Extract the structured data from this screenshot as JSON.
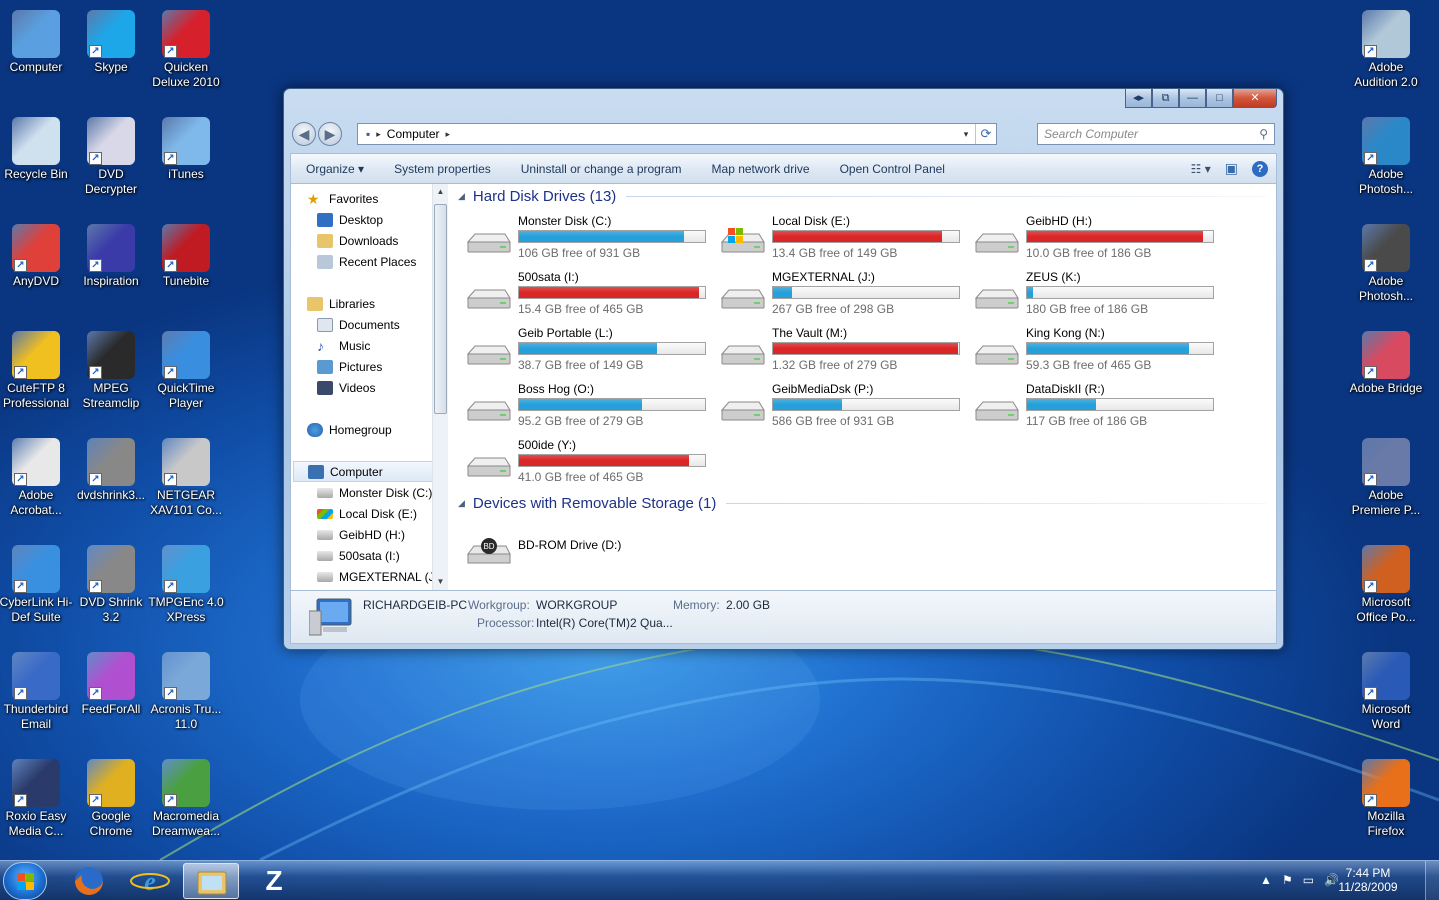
{
  "desktop": {
    "left_icons": [
      {
        "label": "Computer",
        "icon": "computer-icon",
        "color": "#5aa0e0"
      },
      {
        "label": "Skype",
        "icon": "skype-icon",
        "color": "#1ea7e8"
      },
      {
        "label": "Quicken Deluxe 2010",
        "icon": "quicken-icon",
        "color": "#d6202b"
      },
      {
        "label": "Recycle Bin",
        "icon": "recycle-bin-icon",
        "color": "#cfe0ef"
      },
      {
        "label": "DVD Decrypter",
        "icon": "dvd-decrypter-icon",
        "color": "#d8d8e8"
      },
      {
        "label": "iTunes",
        "icon": "itunes-icon",
        "color": "#7fb8ea"
      },
      {
        "label": "AnyDVD",
        "icon": "anydvd-icon",
        "color": "#e0403a"
      },
      {
        "label": "Inspiration",
        "icon": "inspiration-icon",
        "color": "#3a3aa8"
      },
      {
        "label": "Tunebite",
        "icon": "tunebite-icon",
        "color": "#c01a22"
      },
      {
        "label": "CuteFTP 8 Professional",
        "icon": "cuteftp-icon",
        "color": "#f0c020"
      },
      {
        "label": "MPEG Streamclip",
        "icon": "mpeg-streamclip-icon",
        "color": "#2a2a2a"
      },
      {
        "label": "QuickTime Player",
        "icon": "quicktime-icon",
        "color": "#3a8ee0"
      },
      {
        "label": "Adobe Acrobat...",
        "icon": "adobe-acrobat-icon",
        "color": "#e8e8e8"
      },
      {
        "label": "dvdshrink3...",
        "icon": "dvdshrink-icon",
        "color": "#888888"
      },
      {
        "label": "NETGEAR XAV101 Co...",
        "icon": "netgear-icon",
        "color": "#c8c8c8"
      },
      {
        "label": "CyberLink Hi-Def Suite",
        "icon": "cyberlink-icon",
        "color": "#3a90e0"
      },
      {
        "label": "DVD Shrink 3.2",
        "icon": "dvd-shrink-icon",
        "color": "#888888"
      },
      {
        "label": "TMPGEnc 4.0 XPress",
        "icon": "tmpgenc-icon",
        "color": "#3aa0e0"
      },
      {
        "label": "Thunderbird Email",
        "icon": "thunderbird-icon",
        "color": "#3a6ac8"
      },
      {
        "label": "FeedForAll",
        "icon": "feedforall-icon",
        "color": "#b050d0"
      },
      {
        "label": "Acronis Tru... 11.0",
        "icon": "acronis-icon",
        "color": "#7aa8d8"
      },
      {
        "label": "Roxio Easy Media C...",
        "icon": "roxio-icon",
        "color": "#2a3a6a"
      },
      {
        "label": "Google Chrome",
        "icon": "chrome-icon",
        "color": "#e0b020"
      },
      {
        "label": "Macromedia Dreamwea...",
        "icon": "dreamweaver-icon",
        "color": "#4aa040"
      }
    ],
    "right_icons": [
      {
        "label": "Adobe Audition 2.0",
        "icon": "adobe-audition-icon",
        "color": "#b0c8d8"
      },
      {
        "label": "Adobe Photosh...",
        "icon": "adobe-photoshop-icon",
        "color": "#2a88c8"
      },
      {
        "label": "Adobe Photosh...",
        "icon": "adobe-lightroom-icon",
        "color": "#4a4a4a"
      },
      {
        "label": "Adobe Bridge",
        "icon": "adobe-bridge-icon",
        "color": "#d84a60"
      },
      {
        "label": "Adobe Premiere P...",
        "icon": "adobe-premiere-icon",
        "color": "#6a7aa8"
      },
      {
        "label": "Microsoft Office Po...",
        "icon": "powerpoint-icon",
        "color": "#d06020"
      },
      {
        "label": "Microsoft Word",
        "icon": "word-icon",
        "color": "#2a5ab8"
      },
      {
        "label": "Mozilla Firefox",
        "icon": "firefox-icon",
        "color": "#e8701a"
      }
    ]
  },
  "window": {
    "caption_buttons": [
      "◂▸",
      "⧉",
      "—",
      "□",
      "✕"
    ],
    "address": {
      "root_glyph": "▪",
      "separator": "▸",
      "location": "Computer",
      "dropdown": "▾",
      "refresh": "⟳"
    },
    "search": {
      "placeholder": "Search Computer",
      "glyph": "⚲"
    },
    "toolbar": {
      "organize": "Organize ▾",
      "system_properties": "System properties",
      "uninstall": "Uninstall or change a program",
      "map_drive": "Map network drive",
      "control_panel": "Open Control Panel",
      "views_glyph": "☷ ▾",
      "preview_glyph": "▣",
      "help": "?"
    },
    "nav": {
      "favorites": "Favorites",
      "desktop": "Desktop",
      "downloads": "Downloads",
      "recent": "Recent Places",
      "libraries": "Libraries",
      "documents": "Documents",
      "music": "Music",
      "pictures": "Pictures",
      "videos": "Videos",
      "homegroup": "Homegroup",
      "computer": "Computer",
      "drives": [
        "Monster Disk (C:)",
        "Local Disk (E:)",
        "GeibHD (H:)",
        "500sata (I:)",
        "MGEXTERNAL (J:)"
      ]
    },
    "groups": {
      "hdd": "Hard Disk Drives (13)",
      "removable": "Devices with Removable Storage (1)"
    },
    "drives": [
      {
        "name": "Monster Disk (C:)",
        "free": "106 GB free of 931 GB",
        "used": 0.886,
        "status": "normal"
      },
      {
        "name": "Local Disk (E:)",
        "free": "13.4 GB free of 149 GB",
        "used": 0.91,
        "status": "low",
        "system": true
      },
      {
        "name": "GeibHD (H:)",
        "free": "10.0 GB free of 186 GB",
        "used": 0.946,
        "status": "low"
      },
      {
        "name": "500sata (I:)",
        "free": "15.4 GB free of 465 GB",
        "used": 0.967,
        "status": "low"
      },
      {
        "name": "MGEXTERNAL (J:)",
        "free": "267 GB free of 298 GB",
        "used": 0.104,
        "status": "normal"
      },
      {
        "name": "ZEUS (K:)",
        "free": "180 GB free of 186 GB",
        "used": 0.032,
        "status": "normal"
      },
      {
        "name": "Geib Portable (L:)",
        "free": "38.7 GB free of 149 GB",
        "used": 0.74,
        "status": "normal"
      },
      {
        "name": "The Vault (M:)",
        "free": "1.32 GB free of 279 GB",
        "used": 0.995,
        "status": "low"
      },
      {
        "name": "King Kong (N:)",
        "free": "59.3 GB free of 465 GB",
        "used": 0.872,
        "status": "normal"
      },
      {
        "name": "Boss Hog (O:)",
        "free": "95.2 GB free of 279 GB",
        "used": 0.659,
        "status": "normal"
      },
      {
        "name": "GeibMediaDsk (P:)",
        "free": "586 GB free of 931 GB",
        "used": 0.371,
        "status": "normal"
      },
      {
        "name": "DataDiskII (R:)",
        "free": "117 GB free of 186 GB",
        "used": 0.371,
        "status": "normal"
      },
      {
        "name": "500ide (Y:)",
        "free": "41.0 GB free of 465 GB",
        "used": 0.912,
        "status": "low"
      }
    ],
    "removable": [
      {
        "name": "BD-ROM Drive (D:)",
        "badge": "BD"
      }
    ],
    "details": {
      "computer_name": "RICHARDGEIB-PC",
      "workgroup_label": "Workgroup:",
      "workgroup": "WORKGROUP",
      "memory_label": "Memory:",
      "memory": "2.00 GB",
      "processor_label": "Processor:",
      "processor": "Intel(R) Core(TM)2 Qua..."
    }
  },
  "taskbar": {
    "pinned": [
      {
        "icon": "firefox-icon"
      },
      {
        "icon": "internet-explorer-icon"
      },
      {
        "icon": "windows-explorer-icon",
        "active": true
      },
      {
        "icon": "z-app-icon",
        "glyph": "Z"
      }
    ],
    "tray_glyphs": [
      "▲",
      "⚑",
      "▭",
      "🔊"
    ],
    "time": "7:44 PM",
    "date": "11/28/2009"
  },
  "colors": {
    "bar_normal": "#26a0da",
    "bar_low": "#da2626",
    "title_blue": "#1e3287"
  }
}
